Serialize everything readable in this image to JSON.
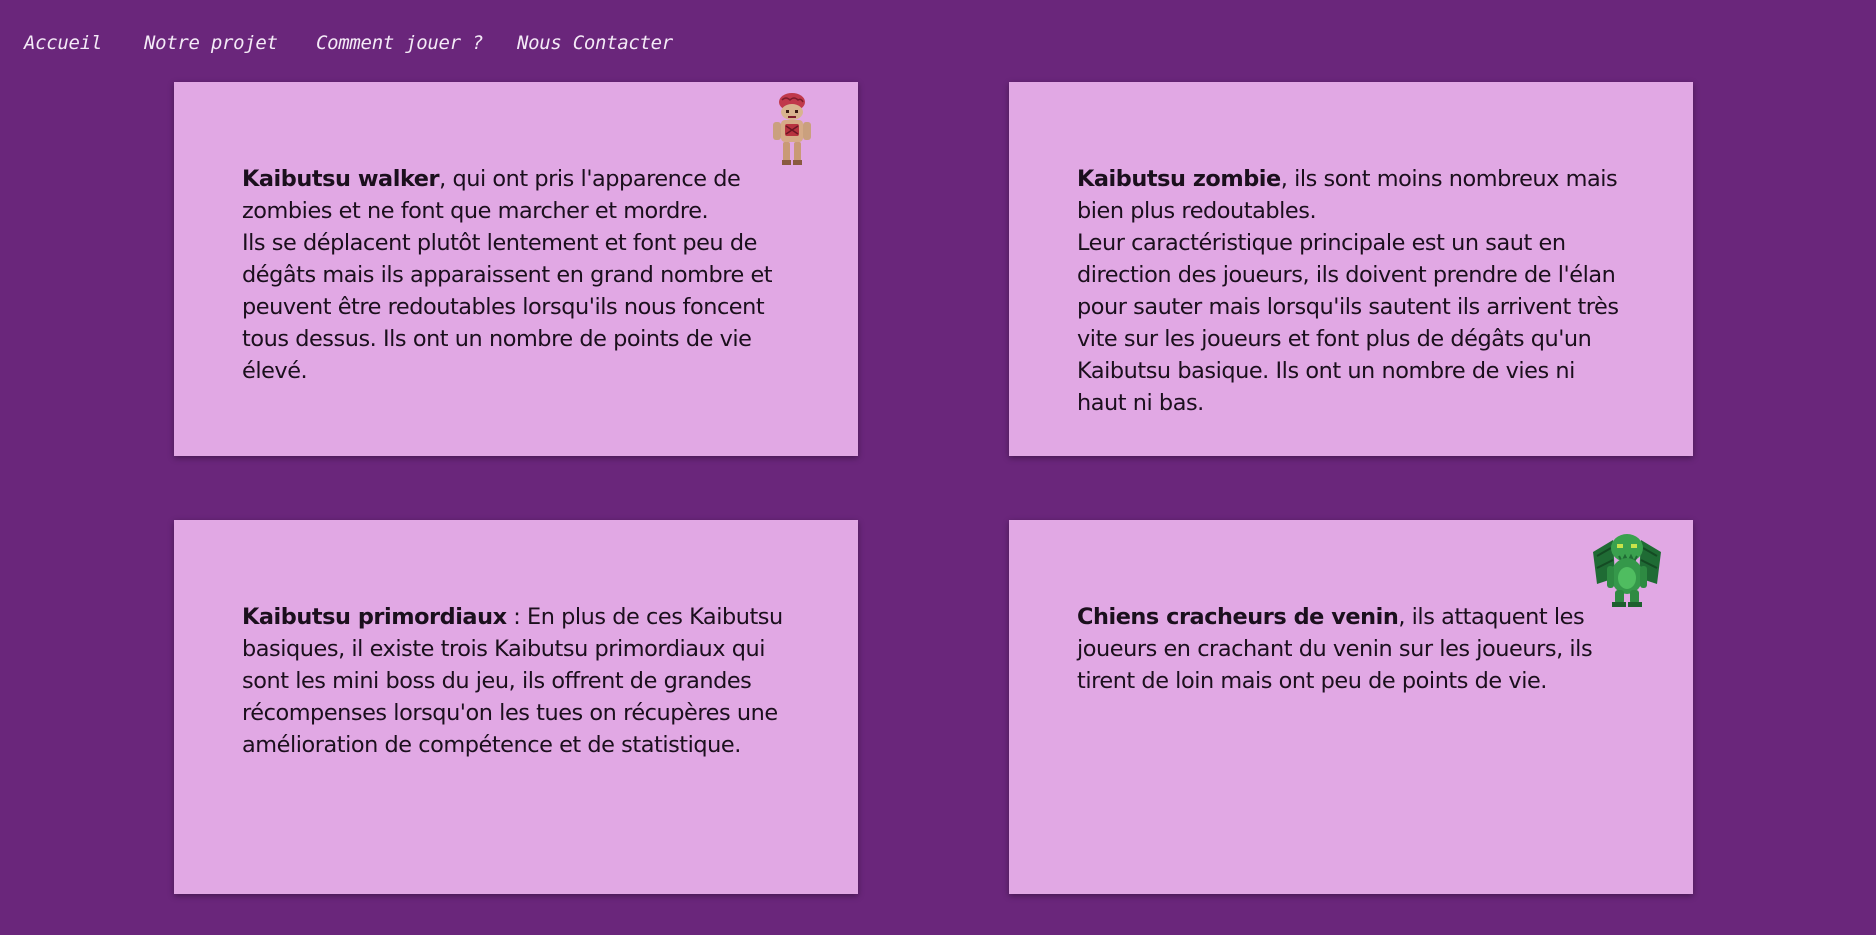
{
  "nav": {
    "items": [
      {
        "label": "Accueil"
      },
      {
        "label": "Notre projet"
      },
      {
        "label": "Comment jouer ?"
      },
      {
        "label": "Nous Contacter"
      }
    ]
  },
  "cards": [
    {
      "name": "Kaibutsu walker",
      "text": ", qui ont pris l'apparence de zombies et ne font que marcher et mordre.",
      "text2": "Ils se déplacent plutôt lentement et font peu de dégâts mais ils apparaissent en grand nombre et peuvent être redoutables lorsqu'ils nous foncent tous dessus. Ils ont un nombre de points de vie élevé.",
      "icon": "zombie-walker-sprite-icon"
    },
    {
      "name": "Kaibutsu zombie",
      "text": ", ils sont moins nombreux mais bien plus redoutables.",
      "text2": "Leur caractéristique principale est un saut en direction des joueurs, ils doivent prendre de l'élan pour sauter mais lorsqu'ils sautent ils arrivent très vite sur les joueurs et font plus de dégâts qu'un Kaibutsu basique. Ils ont un nombre de vies ni haut ni bas."
    },
    {
      "name": "Kaibutsu primordiaux",
      "text": " : En plus de ces Kaibutsu basiques, il existe trois Kaibutsu primordiaux qui sont les mini boss du jeu, ils offrent de grandes récompenses lorsqu'on les tues on récupères une amélioration de compétence et de statistique."
    },
    {
      "name": "Chiens cracheurs de venin",
      "text": ", ils attaquent les joueurs en crachant du venin sur les joueurs, ils tirent de loin mais ont peu de points de vie.",
      "icon": "green-winged-creature-sprite-icon"
    }
  ],
  "colors": {
    "background": "#6a267b",
    "card": "#e1a8e4",
    "nav_text": "#f4eaf7",
    "body_text": "#1b0f1d"
  }
}
